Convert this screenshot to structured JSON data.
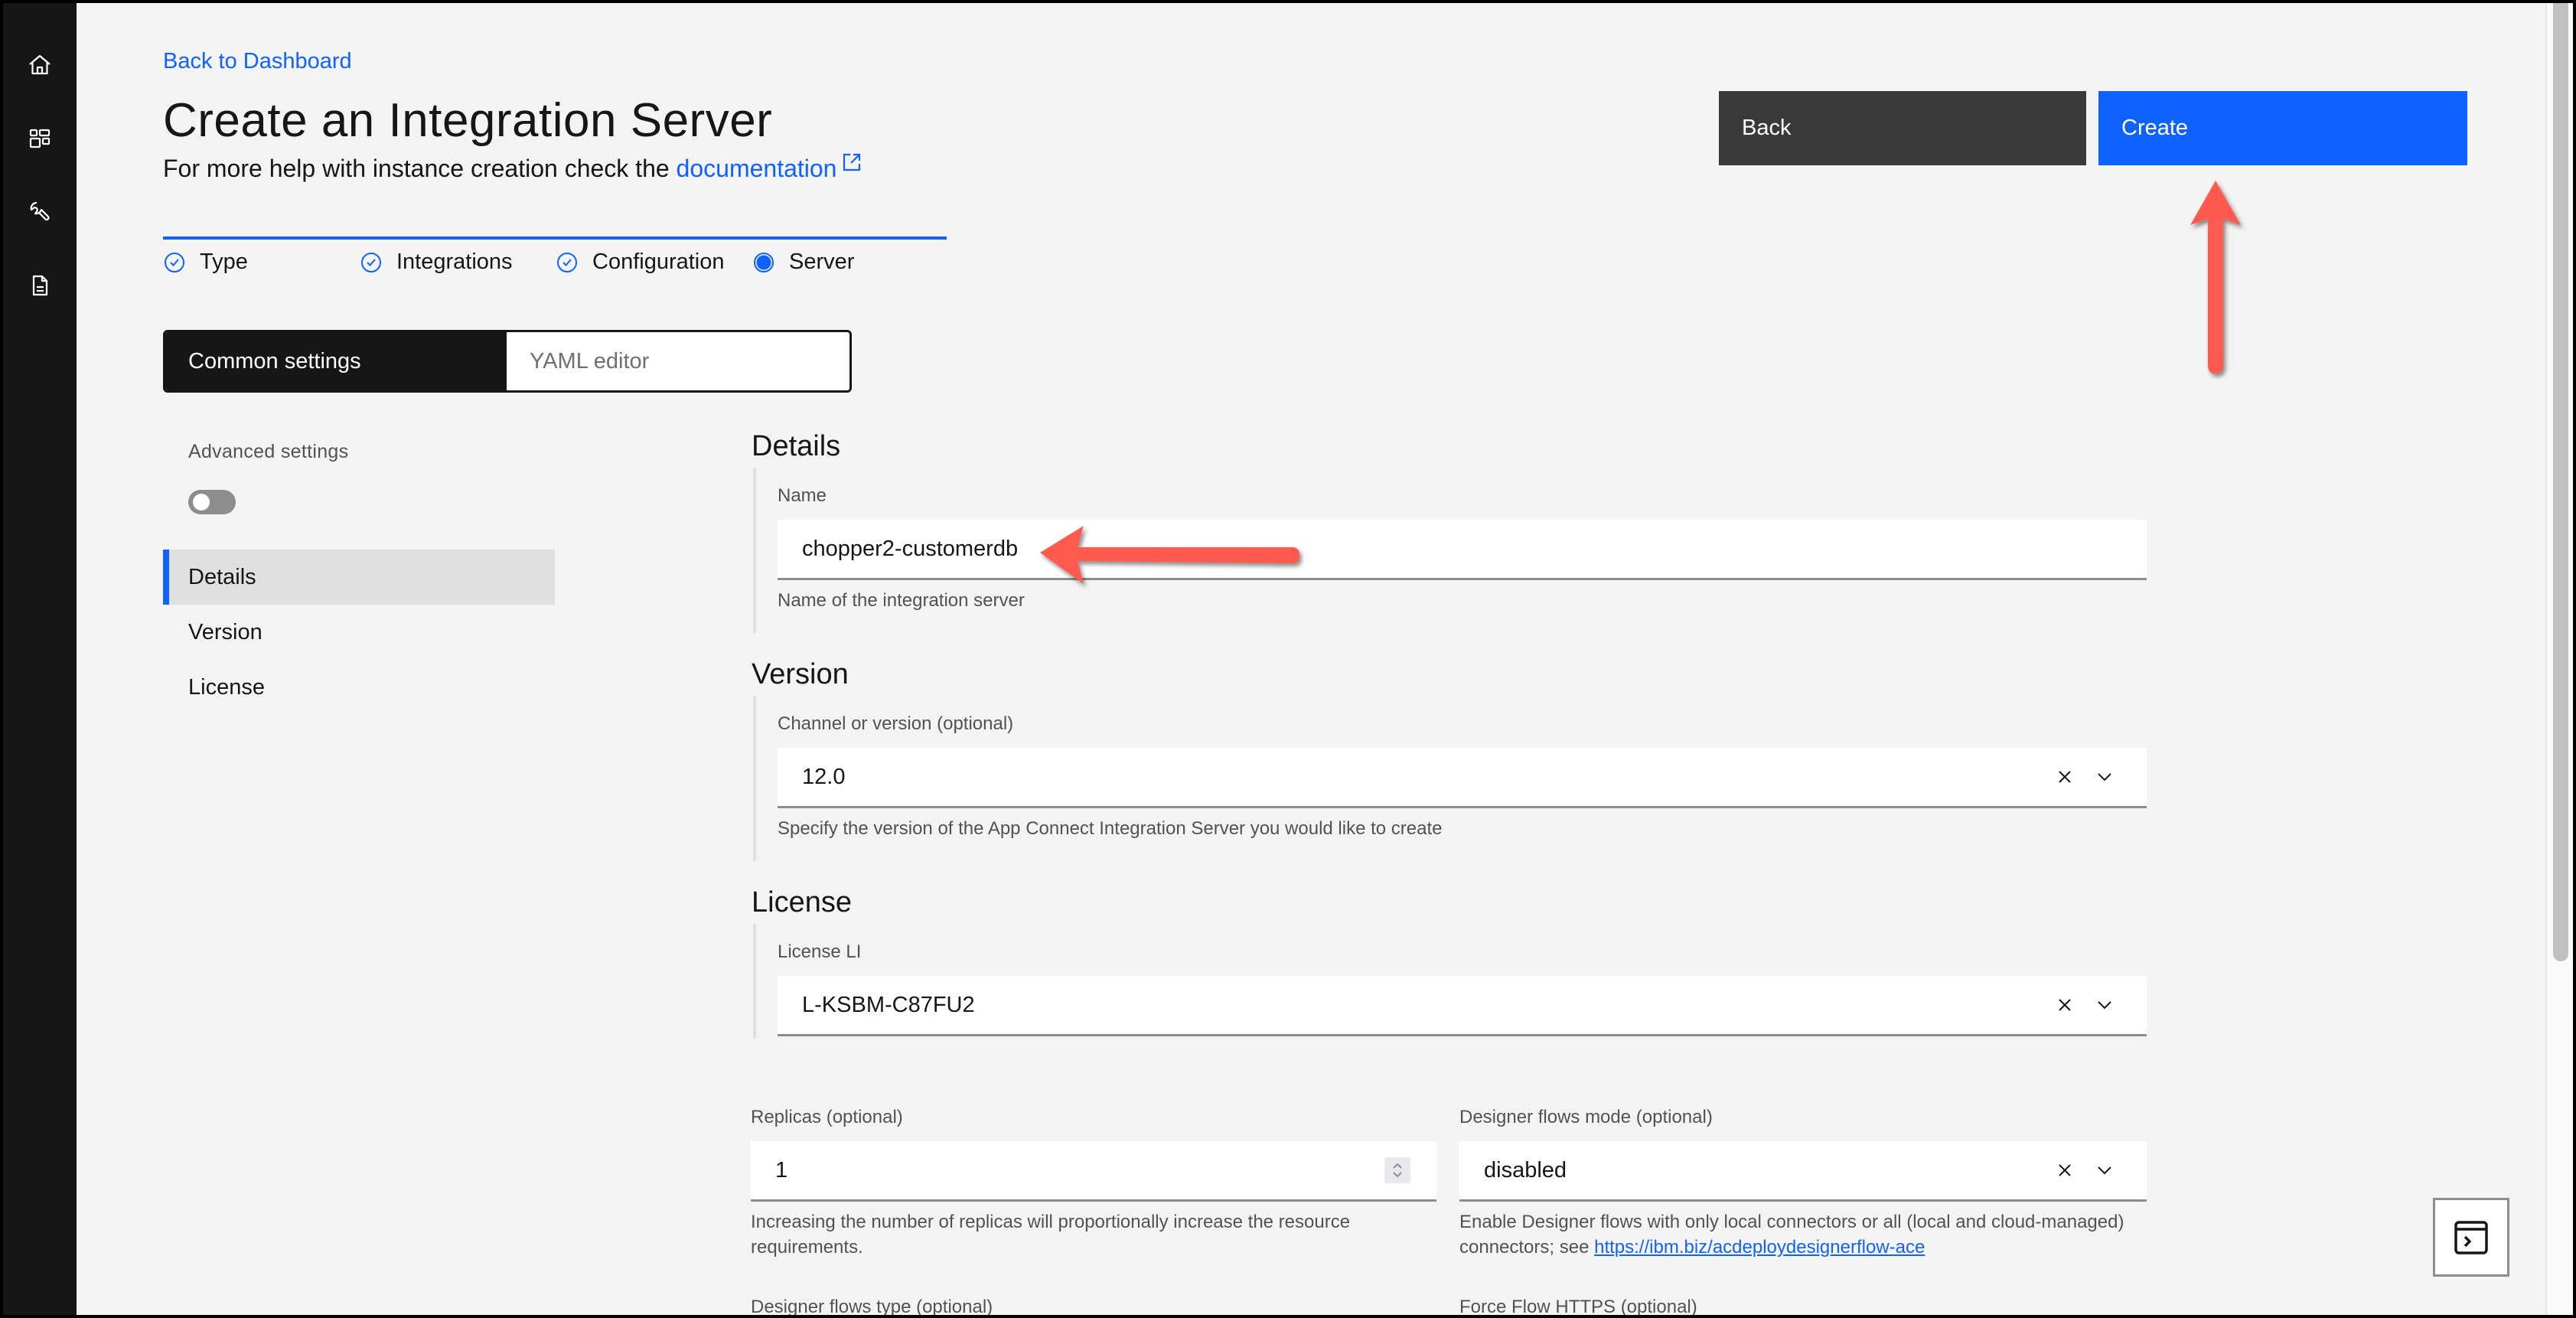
{
  "rail": {
    "items": [
      {
        "icon": "home-icon",
        "label": "Home"
      },
      {
        "icon": "dashboard-icon",
        "label": "Dashboard"
      },
      {
        "icon": "wrench-icon",
        "label": "Tools"
      },
      {
        "icon": "document-icon",
        "label": "Documents"
      }
    ]
  },
  "header": {
    "back_link": "Back to Dashboard",
    "title": "Create an Integration Server",
    "subtitle_prefix": "For more help with instance creation check the",
    "subtitle_link": "documentation"
  },
  "actions": {
    "back_label": "Back",
    "create_label": "Create"
  },
  "progress": {
    "steps": [
      {
        "label": "Type",
        "state": "complete"
      },
      {
        "label": "Integrations",
        "state": "complete"
      },
      {
        "label": "Configuration",
        "state": "complete"
      },
      {
        "label": "Server",
        "state": "current"
      }
    ]
  },
  "tabs": {
    "active": "Common settings",
    "inactive": "YAML editor"
  },
  "settings_nav": {
    "advanced_label": "Advanced settings",
    "advanced_enabled": false,
    "items": [
      {
        "label": "Details",
        "active": true
      },
      {
        "label": "Version",
        "active": false
      },
      {
        "label": "License",
        "active": false
      }
    ]
  },
  "form": {
    "details": {
      "title": "Details",
      "name_label": "Name",
      "name_value": "chopper2-customerdb",
      "name_helper": "Name of the integration server"
    },
    "version": {
      "title": "Version",
      "label": "Channel or version (optional)",
      "value": "12.0",
      "helper": "Specify the version of the App Connect Integration Server you would like to create"
    },
    "license": {
      "title": "License",
      "label": "License LI",
      "value": "L-KSBM-C87FU2"
    },
    "replicas": {
      "label": "Replicas (optional)",
      "value": "1",
      "helper": "Increasing the number of replicas will proportionally increase the resource requirements."
    },
    "designer_mode": {
      "label": "Designer flows mode (optional)",
      "value": "disabled",
      "helper_prefix": "Enable Designer flows with only local connectors or all (local and cloud-managed) connectors; see",
      "helper_link": "https://ibm.biz/acdeploydesignerflow-ace"
    },
    "designer_type": {
      "label": "Designer flows type (optional)"
    },
    "force_https": {
      "label": "Force Flow HTTPS (optional)"
    }
  },
  "colors": {
    "primary": "#0f62fe",
    "rail": "#161616",
    "secondary_button": "#393939",
    "annotation_arrow": "#ff5a4e"
  }
}
